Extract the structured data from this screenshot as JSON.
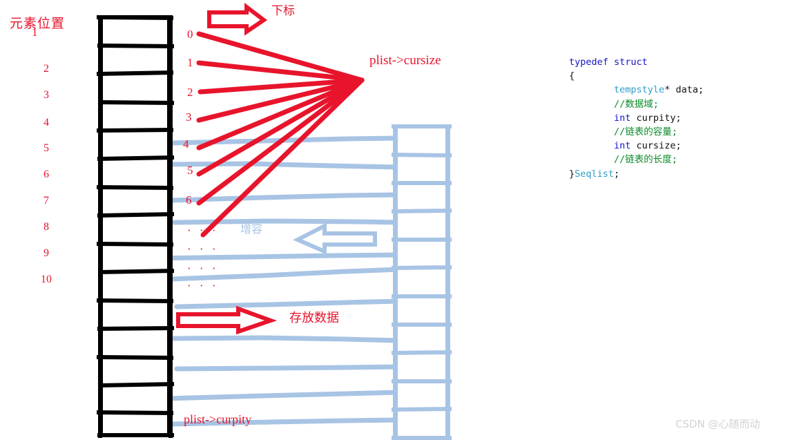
{
  "diagram": {
    "title_label": "元素位置",
    "title_sub": "1",
    "left_axis_label": "元素位置",
    "position_numbers": [
      "2",
      "3",
      "4",
      "5",
      "6",
      "7",
      "8",
      "9",
      "10"
    ],
    "index_numbers": [
      "0",
      "1",
      "2",
      "3",
      "4",
      "5",
      "6"
    ],
    "index_ellipses": [
      "· · ·",
      "· · ·",
      "· · ·",
      "· · ·"
    ],
    "labels": {
      "subscript": "下标",
      "cursize": "plist->cursize",
      "expand_capacity": "增容",
      "store_data": "存放数据",
      "curpity": "plist->curpity"
    },
    "colors": {
      "red": "#e8142c",
      "light_blue": "#a8c4e5",
      "black": "#000000",
      "code_keyword": "#1414c8",
      "code_type": "#2e9ec8",
      "code_comment": "#0a8a28",
      "code_plain": "#101010",
      "watermark": "#d2d2d2"
    },
    "left_table": {
      "rows": 15,
      "border_color": "#000000"
    },
    "right_table": {
      "rows": 11,
      "border_color": "#a8c4e5"
    }
  },
  "code": {
    "lines": [
      [
        {
          "t": "typedef struct",
          "c": "kw"
        }
      ],
      [
        {
          "t": "{",
          "c": "pl"
        }
      ],
      [
        {
          "t": "        ",
          "c": "pl"
        },
        {
          "t": "tempstyle",
          "c": "ty"
        },
        {
          "t": "* data;",
          "c": "pl"
        }
      ],
      [
        {
          "t": "        ",
          "c": "pl"
        },
        {
          "t": "//数据域;",
          "c": "cm"
        }
      ],
      [
        {
          "t": "        ",
          "c": "pl"
        },
        {
          "t": "int",
          "c": "kw"
        },
        {
          "t": " curpity;",
          "c": "pl"
        }
      ],
      [
        {
          "t": "        ",
          "c": "pl"
        },
        {
          "t": "//链表的容量;",
          "c": "cm"
        }
      ],
      [
        {
          "t": "        ",
          "c": "pl"
        },
        {
          "t": "int",
          "c": "kw"
        },
        {
          "t": " cursize;",
          "c": "pl"
        }
      ],
      [
        {
          "t": "        ",
          "c": "pl"
        },
        {
          "t": "//链表的长度;",
          "c": "cm"
        }
      ],
      [
        {
          "t": "}",
          "c": "pl"
        },
        {
          "t": "Seqlist",
          "c": "ty"
        },
        {
          "t": ";",
          "c": "pl"
        }
      ]
    ]
  },
  "watermark": {
    "text": "CSDN @心随而动"
  }
}
